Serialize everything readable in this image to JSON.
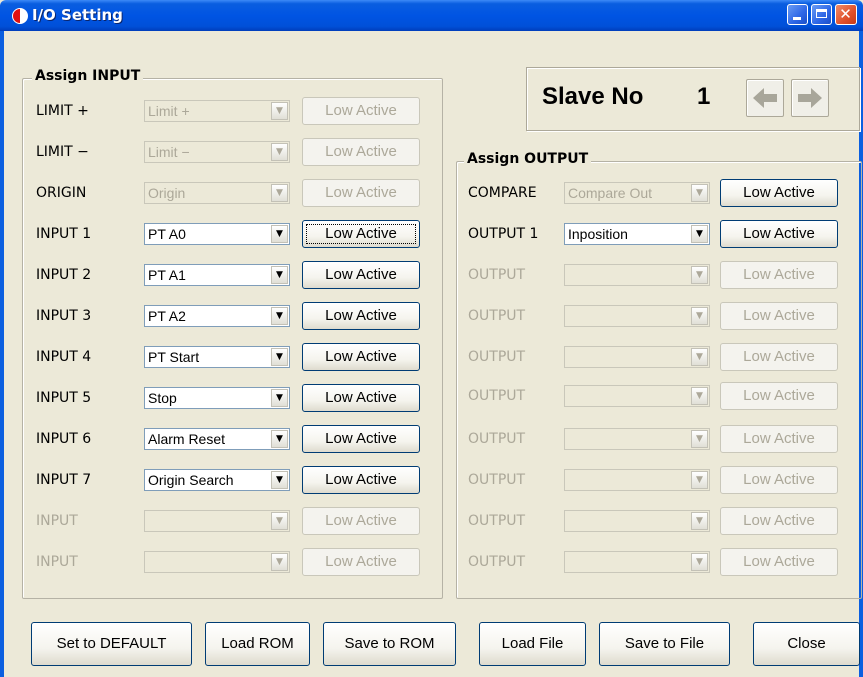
{
  "window": {
    "title": "I/O Setting",
    "icon": "red-half-circle-icon",
    "controls": [
      "minimize",
      "maximize",
      "close"
    ],
    "close_glyph": "✕"
  },
  "slave": {
    "label": "Slave No",
    "number": "1"
  },
  "input_group": {
    "title": "Assign INPUT",
    "rows": [
      {
        "label": "LIMIT +",
        "value": "Limit +",
        "button": "Low Active",
        "enabled": false,
        "label_enabled": true
      },
      {
        "label": "LIMIT −",
        "value": "Limit −",
        "button": "Low Active",
        "enabled": false,
        "label_enabled": true
      },
      {
        "label": "ORIGIN",
        "value": "Origin",
        "button": "Low Active",
        "enabled": false,
        "label_enabled": true
      },
      {
        "label": "INPUT 1",
        "value": "PT A0",
        "button": "Low Active",
        "enabled": true,
        "label_enabled": true,
        "focused": true
      },
      {
        "label": "INPUT 2",
        "value": "PT A1",
        "button": "Low Active",
        "enabled": true,
        "label_enabled": true
      },
      {
        "label": "INPUT 3",
        "value": "PT A2",
        "button": "Low Active",
        "enabled": true,
        "label_enabled": true
      },
      {
        "label": "INPUT 4",
        "value": "PT Start",
        "button": "Low Active",
        "enabled": true,
        "label_enabled": true
      },
      {
        "label": "INPUT 5",
        "value": "Stop",
        "button": "Low Active",
        "enabled": true,
        "label_enabled": true
      },
      {
        "label": "INPUT 6",
        "value": "Alarm Reset",
        "button": "Low Active",
        "enabled": true,
        "label_enabled": true
      },
      {
        "label": "INPUT 7",
        "value": "Origin Search",
        "button": "Low Active",
        "enabled": true,
        "label_enabled": true
      },
      {
        "label": "INPUT",
        "value": "",
        "button": "Low Active",
        "enabled": false,
        "label_enabled": false
      },
      {
        "label": "INPUT",
        "value": "",
        "button": "Low Active",
        "enabled": false,
        "label_enabled": false
      }
    ]
  },
  "output_group": {
    "title": "Assign OUTPUT",
    "rows": [
      {
        "label": "COMPARE",
        "value": "Compare Out",
        "button": "Low Active",
        "combo_enabled": false,
        "button_enabled": true,
        "label_enabled": true
      },
      {
        "label": "OUTPUT 1",
        "value": "Inposition",
        "button": "Low Active",
        "combo_enabled": true,
        "button_enabled": true,
        "label_enabled": true
      },
      {
        "label": "OUTPUT",
        "value": "",
        "button": "Low Active",
        "combo_enabled": false,
        "button_enabled": false,
        "label_enabled": false
      },
      {
        "label": "OUTPUT",
        "value": "",
        "button": "Low Active",
        "combo_enabled": false,
        "button_enabled": false,
        "label_enabled": false
      },
      {
        "label": "OUTPUT",
        "value": "",
        "button": "Low Active",
        "combo_enabled": false,
        "button_enabled": false,
        "label_enabled": false
      },
      {
        "label": "OUTPUT",
        "value": "",
        "button": "Low Active",
        "combo_enabled": false,
        "button_enabled": false,
        "label_enabled": false
      },
      {
        "label": "OUTPUT",
        "value": "",
        "button": "Low Active",
        "combo_enabled": false,
        "button_enabled": false,
        "label_enabled": false
      },
      {
        "label": "OUTPUT",
        "value": "",
        "button": "Low Active",
        "combo_enabled": false,
        "button_enabled": false,
        "label_enabled": false
      },
      {
        "label": "OUTPUT",
        "value": "",
        "button": "Low Active",
        "combo_enabled": false,
        "button_enabled": false,
        "label_enabled": false
      },
      {
        "label": "OUTPUT",
        "value": "",
        "button": "Low Active",
        "combo_enabled": false,
        "button_enabled": false,
        "label_enabled": false
      }
    ]
  },
  "footer": {
    "buttons": [
      "Set to DEFAULT",
      "Load ROM",
      "Save to ROM",
      "Load File",
      "Save to File",
      "Close"
    ]
  },
  "colors": {
    "titlebar": "#0054e3",
    "dialog_bg": "#ece9d8",
    "disabled_text": "#aca899",
    "arrow_icon": "#a8a69a"
  }
}
